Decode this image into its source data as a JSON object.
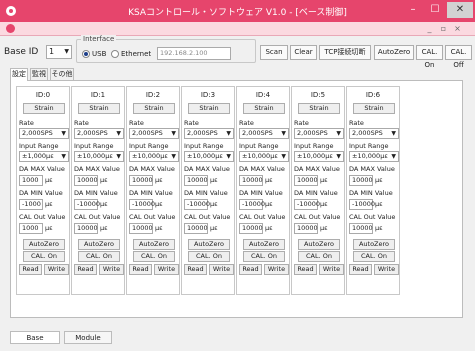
{
  "window": {
    "title": "KSAコントロール・ソフトウェア V1.0 - [ベース制御]",
    "minimize": "–",
    "maximize": "☐",
    "close": "✕"
  },
  "menubar": {
    "mdi_min": "_",
    "mdi_max": "▫",
    "mdi_close": "×"
  },
  "toolbar": {
    "base_id_label": "Base ID",
    "base_id_value": "1",
    "interface_legend": "Interface",
    "usb_label": "USB",
    "ethernet_label": "Ethernet",
    "ip_address": "192.168.2.100",
    "buttons": [
      "Scan",
      "Clear",
      "TCP接続切断",
      "AutoZero",
      "CAL. On",
      "CAL. Off"
    ]
  },
  "tabs": [
    "設定",
    "監視",
    "その他"
  ],
  "channel_labels": {
    "rate": "Rate",
    "input_range": "Input Range",
    "da_max": "DA MAX Value",
    "da_min": "DA MIN Value",
    "cal_out": "CAL Out Value",
    "strain_btn": "Strain",
    "autozero_btn": "AutoZero",
    "cal_on_btn": "CAL. On",
    "read_btn": "Read",
    "write_btn": "Write",
    "unit": "με"
  },
  "channels": [
    {
      "id": "ID:0",
      "rate": "2,000SPS",
      "range": "±1,000με",
      "da_max": "1000",
      "da_min": "-1000",
      "cal_out": "1000"
    },
    {
      "id": "ID:1",
      "rate": "2,000SPS",
      "range": "±10,000με",
      "da_max": "10000",
      "da_min": "-10000",
      "cal_out": "10000"
    },
    {
      "id": "ID:2",
      "rate": "2,000SPS",
      "range": "±10,000με",
      "da_max": "10000",
      "da_min": "-10000",
      "cal_out": "10000"
    },
    {
      "id": "ID:3",
      "rate": "2,000SPS",
      "range": "±10,000με",
      "da_max": "10000",
      "da_min": "-10000",
      "cal_out": "10000"
    },
    {
      "id": "ID:4",
      "rate": "2,000SPS",
      "range": "±10,000με",
      "da_max": "10000",
      "da_min": "-10000",
      "cal_out": "10000"
    },
    {
      "id": "ID:5",
      "rate": "2,000SPS",
      "range": "±10,000με",
      "da_max": "10000",
      "da_min": "-10000",
      "cal_out": "10000"
    },
    {
      "id": "ID:6",
      "rate": "2,000SPS",
      "range": "±10,000με",
      "da_max": "10000",
      "da_min": "-10000",
      "cal_out": "10000"
    }
  ],
  "bottom_tabs": [
    "Base",
    "Module"
  ],
  "colors": {
    "title_bar": "#e6456c",
    "menu_bar": "#fbd9e0"
  }
}
